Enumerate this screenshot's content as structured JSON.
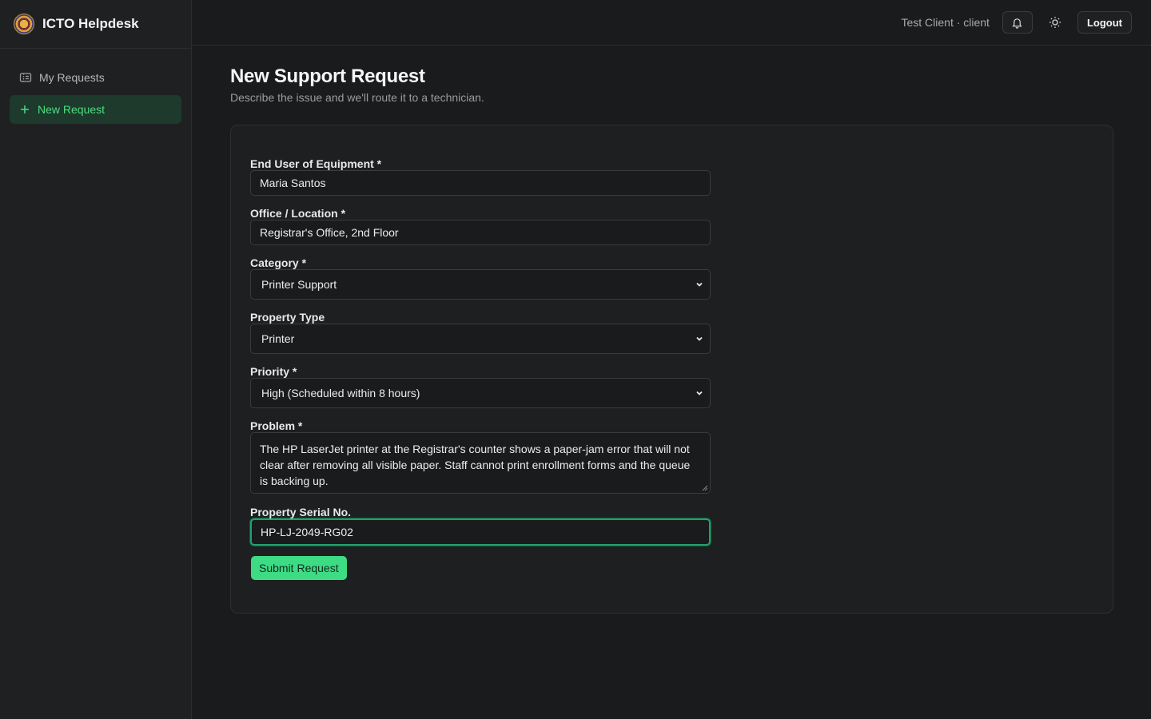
{
  "brand": {
    "name": "ICTO Helpdesk"
  },
  "sidebar": {
    "items": [
      {
        "label": "My Requests",
        "icon": "ticket-icon",
        "active": false
      },
      {
        "label": "New Request",
        "icon": "plus-icon",
        "active": true
      }
    ]
  },
  "header": {
    "user": "Test Client · client",
    "logout_label": "Logout"
  },
  "page": {
    "title": "New Support Request",
    "subtitle": "Describe the issue and we'll route it to a technician."
  },
  "form": {
    "end_user": {
      "label": "End User of Equipment *",
      "value": "Maria Santos"
    },
    "office": {
      "label": "Office / Location *",
      "value": "Registrar's Office, 2nd Floor"
    },
    "category": {
      "label": "Category *",
      "value": "Printer Support"
    },
    "property_type": {
      "label": "Property Type",
      "value": "Printer"
    },
    "priority": {
      "label": "Priority *",
      "value": "High (Scheduled within 8 hours)"
    },
    "problem": {
      "label": "Problem *",
      "value": "The HP LaserJet printer at the Registrar's counter shows a paper-jam error that will not clear after removing all visible paper. Staff cannot print enrollment forms and the queue is backing up."
    },
    "serial": {
      "label": "Property Serial No.",
      "value": "HP-LJ-2049-RG02"
    },
    "submit_label": "Submit Request"
  },
  "colors": {
    "accent": "#3ddc84",
    "active_nav_bg": "#1d3a2c",
    "focus_border": "#22a06b"
  }
}
